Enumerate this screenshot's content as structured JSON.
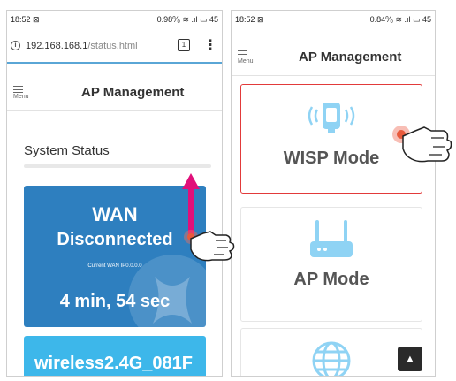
{
  "left_screen": {
    "status_bar": {
      "time": "18:52 ⊠",
      "right": "0.98⁰⁄₀ ≋ .ıl ▭ 45"
    },
    "url_bar": {
      "host": "192.168.168.1",
      "path": "/status.html",
      "tab_count": "1",
      "more": "⋮"
    },
    "header": {
      "menu_label": "Menu",
      "title": "AP Management"
    },
    "section_title": "System Status",
    "wan_card": {
      "title": "WAN",
      "status": "Disconnected",
      "ip_label": "Current WAN IP0.0.0.0",
      "uptime": "4 min, 54 sec"
    },
    "wireless_card": {
      "ssid": "wireless2.4G_081F"
    }
  },
  "right_screen": {
    "status_bar": {
      "time": "18:52 ⊠",
      "right": "0.84⁰⁄₀ ≋ .ıl ▭ 45"
    },
    "header": {
      "menu_label": "Menu",
      "title": "AP Management"
    },
    "cards": [
      {
        "label": "WISP Mode",
        "icon": "wifi-extender-icon"
      },
      {
        "label": "AP Mode",
        "icon": "router-icon"
      },
      {
        "label": "",
        "icon": "globe-icon"
      }
    ],
    "scroll_top_icon": "chevron-up-icon"
  },
  "colors": {
    "wan_card": "#2e7fbf",
    "wireless_card": "#3db7ea",
    "icon_light_blue": "#8fd3f4",
    "highlight_red": "#e23a3a",
    "arrow_magenta": "#e0107a",
    "url_underline": "#5aa6d6"
  }
}
